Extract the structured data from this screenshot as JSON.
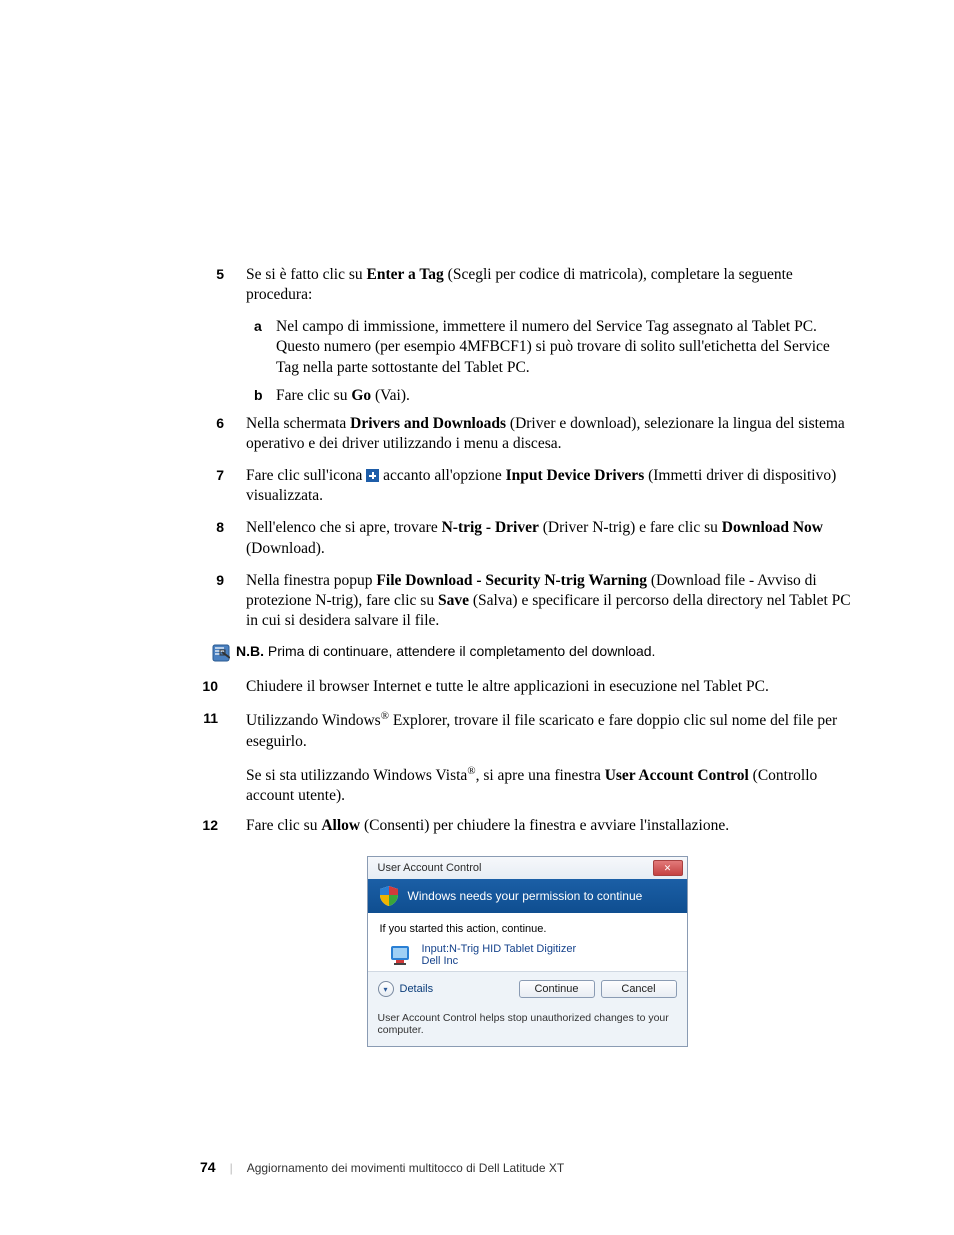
{
  "steps": {
    "5": {
      "pre": "Se si è fatto clic su ",
      "bold": "Enter a Tag",
      "post": " (Scegli per codice di matricola), completare la seguente procedura:"
    },
    "5a": "Nel campo di immissione, immettere il numero del Service Tag assegnato al Tablet PC. Questo numero (per esempio 4MFBCF1) si può trovare di solito sull'etichetta del Service Tag nella parte sottostante del Tablet PC.",
    "5b": {
      "pre": "Fare clic su ",
      "bold": "Go",
      "post": " (Vai)."
    },
    "6": {
      "pre": "Nella schermata ",
      "bold": "Drivers and Downloads",
      "post": " (Driver e download), selezionare la lingua del sistema operativo e dei driver utilizzando i menu a discesa."
    },
    "7": {
      "pre": "Fare clic sull'icona ",
      "mid": " accanto all'opzione ",
      "bold": "Input Device Drivers",
      "post": " (Immetti driver di dispositivo) visualizzata."
    },
    "8": {
      "pre": "Nell'elenco che si apre, trovare ",
      "bold1": "N-trig - Driver",
      "mid": " (Driver N-trig) e fare clic su ",
      "bold2": "Download Now",
      "post": " (Download)."
    },
    "9": {
      "pre": "Nella finestra popup ",
      "bold1": "File Download - Security N-trig Warning",
      "mid": " (Download file - Avviso di protezione N-trig), fare clic su ",
      "bold2": "Save",
      "post": " (Salva) e specificare il percorso della directory nel Tablet PC in cui si desidera salvare il file."
    },
    "note_label": "N.B.",
    "note_text": " Prima di continuare, attendere il completamento del download.",
    "10": "Chiudere il browser Internet e tutte le altre applicazioni in esecuzione nel Tablet PC.",
    "11": {
      "pre": "Utilizzando Windows",
      "post": " Explorer, trovare il file scaricato e fare doppio clic sul nome del file per eseguirlo."
    },
    "11b": {
      "pre": "Se si sta utilizzando Windows Vista",
      "mid": ", si apre una finestra ",
      "bold": "User Account Control",
      "post": " (Controllo account utente)."
    },
    "12": {
      "pre": "Fare clic su ",
      "bold": "Allow",
      "post": " (Consenti) per chiudere la finestra e avviare l'installazione."
    }
  },
  "uac": {
    "title": "User Account Control",
    "banner": "Windows needs your permission to continue",
    "ifstarted": "If you started this action, continue.",
    "prog1": "Input:N-Trig HID Tablet Digitizer",
    "prog2": "Dell Inc",
    "details": "Details",
    "continue": "Continue",
    "cancel": "Cancel",
    "help": "User Account Control helps stop unauthorized changes to your computer."
  },
  "footer": {
    "pagenum": "74",
    "title": "Aggiornamento dei movimenti multitocco di Dell Latitude XT"
  }
}
